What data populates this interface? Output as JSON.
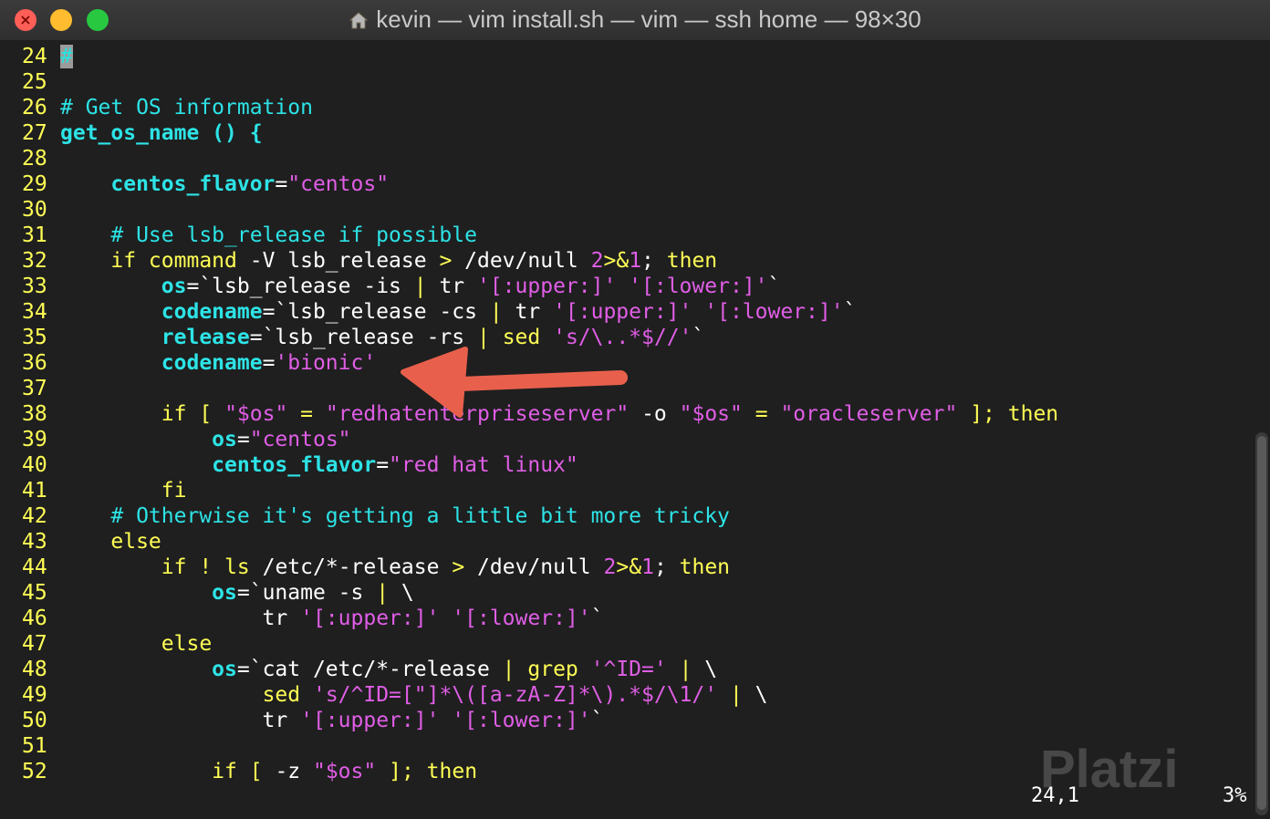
{
  "window": {
    "title": "kevin — vim install.sh — vim — ssh home — 98×30",
    "icon": "home-icon"
  },
  "editor": {
    "lines": [
      {
        "n": "24",
        "tokens": [
          {
            "t": "#",
            "c": "cur"
          }
        ]
      },
      {
        "n": "25",
        "tokens": []
      },
      {
        "n": "26",
        "tokens": [
          {
            "t": "# Get OS information",
            "c": "cmt"
          }
        ]
      },
      {
        "n": "27",
        "tokens": [
          {
            "t": "get_os_name () {",
            "c": "fn"
          }
        ]
      },
      {
        "n": "28",
        "tokens": []
      },
      {
        "n": "29",
        "tokens": [
          {
            "t": "    ",
            "c": "wh"
          },
          {
            "t": "centos_flavor",
            "c": "var"
          },
          {
            "t": "=",
            "c": "wh"
          },
          {
            "t": "\"centos\"",
            "c": "str"
          }
        ]
      },
      {
        "n": "30",
        "tokens": []
      },
      {
        "n": "31",
        "tokens": [
          {
            "t": "    ",
            "c": "wh"
          },
          {
            "t": "# Use lsb_release if possible",
            "c": "cmt"
          }
        ]
      },
      {
        "n": "32",
        "tokens": [
          {
            "t": "    ",
            "c": "wh"
          },
          {
            "t": "if command",
            "c": "kw"
          },
          {
            "t": " -V lsb_release ",
            "c": "wh"
          },
          {
            "t": ">",
            "c": "kw"
          },
          {
            "t": " /dev/null ",
            "c": "wh"
          },
          {
            "t": "2",
            "c": "str"
          },
          {
            "t": ">&",
            "c": "kw"
          },
          {
            "t": "1",
            "c": "str"
          },
          {
            "t": "; ",
            "c": "wh"
          },
          {
            "t": "then",
            "c": "kw"
          }
        ]
      },
      {
        "n": "33",
        "tokens": [
          {
            "t": "        ",
            "c": "wh"
          },
          {
            "t": "os",
            "c": "var"
          },
          {
            "t": "=`lsb_release -is ",
            "c": "wh"
          },
          {
            "t": "|",
            "c": "kw"
          },
          {
            "t": " tr ",
            "c": "wh"
          },
          {
            "t": "'[:upper:]'",
            "c": "str"
          },
          {
            "t": " ",
            "c": "wh"
          },
          {
            "t": "'[:lower:]'",
            "c": "str"
          },
          {
            "t": "`",
            "c": "wh"
          }
        ]
      },
      {
        "n": "34",
        "tokens": [
          {
            "t": "        ",
            "c": "wh"
          },
          {
            "t": "codename",
            "c": "var"
          },
          {
            "t": "=`lsb_release -cs ",
            "c": "wh"
          },
          {
            "t": "|",
            "c": "kw"
          },
          {
            "t": " tr ",
            "c": "wh"
          },
          {
            "t": "'[:upper:]'",
            "c": "str"
          },
          {
            "t": " ",
            "c": "wh"
          },
          {
            "t": "'[:lower:]'",
            "c": "str"
          },
          {
            "t": "`",
            "c": "wh"
          }
        ]
      },
      {
        "n": "35",
        "tokens": [
          {
            "t": "        ",
            "c": "wh"
          },
          {
            "t": "release",
            "c": "var"
          },
          {
            "t": "=`lsb_release -rs ",
            "c": "wh"
          },
          {
            "t": "|",
            "c": "kw"
          },
          {
            "t": " ",
            "c": "wh"
          },
          {
            "t": "sed",
            "c": "kw"
          },
          {
            "t": " ",
            "c": "wh"
          },
          {
            "t": "'s/\\..*$//'",
            "c": "str"
          },
          {
            "t": "`",
            "c": "wh"
          }
        ]
      },
      {
        "n": "36",
        "tokens": [
          {
            "t": "        ",
            "c": "wh"
          },
          {
            "t": "codename",
            "c": "var"
          },
          {
            "t": "=",
            "c": "wh"
          },
          {
            "t": "'bionic'",
            "c": "str"
          }
        ]
      },
      {
        "n": "37",
        "tokens": []
      },
      {
        "n": "38",
        "tokens": [
          {
            "t": "        ",
            "c": "wh"
          },
          {
            "t": "if",
            "c": "kw"
          },
          {
            "t": " ",
            "c": "wh"
          },
          {
            "t": "[",
            "c": "kw"
          },
          {
            "t": " ",
            "c": "wh"
          },
          {
            "t": "\"$os\"",
            "c": "str"
          },
          {
            "t": " ",
            "c": "wh"
          },
          {
            "t": "=",
            "c": "kw"
          },
          {
            "t": " ",
            "c": "wh"
          },
          {
            "t": "\"redhatenterpriseserver\"",
            "c": "str"
          },
          {
            "t": " -o ",
            "c": "wh"
          },
          {
            "t": "\"$os\"",
            "c": "str"
          },
          {
            "t": " ",
            "c": "wh"
          },
          {
            "t": "=",
            "c": "kw"
          },
          {
            "t": " ",
            "c": "wh"
          },
          {
            "t": "\"oracleserver\"",
            "c": "str"
          },
          {
            "t": " ",
            "c": "wh"
          },
          {
            "t": "];",
            "c": "kw"
          },
          {
            "t": " ",
            "c": "wh"
          },
          {
            "t": "then",
            "c": "kw"
          }
        ]
      },
      {
        "n": "39",
        "tokens": [
          {
            "t": "            ",
            "c": "wh"
          },
          {
            "t": "os",
            "c": "var"
          },
          {
            "t": "=",
            "c": "wh"
          },
          {
            "t": "\"centos\"",
            "c": "str"
          }
        ]
      },
      {
        "n": "40",
        "tokens": [
          {
            "t": "            ",
            "c": "wh"
          },
          {
            "t": "centos_flavor",
            "c": "var"
          },
          {
            "t": "=",
            "c": "wh"
          },
          {
            "t": "\"red hat linux\"",
            "c": "str"
          }
        ]
      },
      {
        "n": "41",
        "tokens": [
          {
            "t": "        ",
            "c": "wh"
          },
          {
            "t": "fi",
            "c": "kw"
          }
        ]
      },
      {
        "n": "42",
        "tokens": [
          {
            "t": "    ",
            "c": "wh"
          },
          {
            "t": "# Otherwise it's getting a little bit more tricky",
            "c": "cmt"
          }
        ]
      },
      {
        "n": "43",
        "tokens": [
          {
            "t": "    ",
            "c": "wh"
          },
          {
            "t": "else",
            "c": "kw"
          }
        ]
      },
      {
        "n": "44",
        "tokens": [
          {
            "t": "        ",
            "c": "wh"
          },
          {
            "t": "if",
            "c": "kw"
          },
          {
            "t": " ",
            "c": "wh"
          },
          {
            "t": "!",
            "c": "kw"
          },
          {
            "t": " ",
            "c": "wh"
          },
          {
            "t": "ls",
            "c": "kw"
          },
          {
            "t": " /etc/*-release ",
            "c": "wh"
          },
          {
            "t": ">",
            "c": "kw"
          },
          {
            "t": " /dev/null ",
            "c": "wh"
          },
          {
            "t": "2",
            "c": "str"
          },
          {
            "t": ">&",
            "c": "kw"
          },
          {
            "t": "1",
            "c": "str"
          },
          {
            "t": "; ",
            "c": "wh"
          },
          {
            "t": "then",
            "c": "kw"
          }
        ]
      },
      {
        "n": "45",
        "tokens": [
          {
            "t": "            ",
            "c": "wh"
          },
          {
            "t": "os",
            "c": "var"
          },
          {
            "t": "=`uname -s ",
            "c": "wh"
          },
          {
            "t": "|",
            "c": "kw"
          },
          {
            "t": " \\",
            "c": "wh"
          }
        ]
      },
      {
        "n": "46",
        "tokens": [
          {
            "t": "                tr ",
            "c": "wh"
          },
          {
            "t": "'[:upper:]'",
            "c": "str"
          },
          {
            "t": " ",
            "c": "wh"
          },
          {
            "t": "'[:lower:]'",
            "c": "str"
          },
          {
            "t": "`",
            "c": "wh"
          }
        ]
      },
      {
        "n": "47",
        "tokens": [
          {
            "t": "        ",
            "c": "wh"
          },
          {
            "t": "else",
            "c": "kw"
          }
        ]
      },
      {
        "n": "48",
        "tokens": [
          {
            "t": "            ",
            "c": "wh"
          },
          {
            "t": "os",
            "c": "var"
          },
          {
            "t": "=`cat /etc/*-release ",
            "c": "wh"
          },
          {
            "t": "|",
            "c": "kw"
          },
          {
            "t": " ",
            "c": "wh"
          },
          {
            "t": "grep",
            "c": "kw"
          },
          {
            "t": " ",
            "c": "wh"
          },
          {
            "t": "'^ID='",
            "c": "str"
          },
          {
            "t": " ",
            "c": "wh"
          },
          {
            "t": "|",
            "c": "kw"
          },
          {
            "t": " \\",
            "c": "wh"
          }
        ]
      },
      {
        "n": "49",
        "tokens": [
          {
            "t": "                ",
            "c": "wh"
          },
          {
            "t": "sed",
            "c": "kw"
          },
          {
            "t": " ",
            "c": "wh"
          },
          {
            "t": "'s/^ID=[\"]*\\([a-zA-Z]*\\).*$/\\1/'",
            "c": "str"
          },
          {
            "t": " ",
            "c": "wh"
          },
          {
            "t": "|",
            "c": "kw"
          },
          {
            "t": " \\",
            "c": "wh"
          }
        ]
      },
      {
        "n": "50",
        "tokens": [
          {
            "t": "                tr ",
            "c": "wh"
          },
          {
            "t": "'[:upper:]'",
            "c": "str"
          },
          {
            "t": " ",
            "c": "wh"
          },
          {
            "t": "'[:lower:]'",
            "c": "str"
          },
          {
            "t": "`",
            "c": "wh"
          }
        ]
      },
      {
        "n": "51",
        "tokens": []
      },
      {
        "n": "52",
        "tokens": [
          {
            "t": "            ",
            "c": "wh"
          },
          {
            "t": "if",
            "c": "kw"
          },
          {
            "t": " ",
            "c": "wh"
          },
          {
            "t": "[",
            "c": "kw"
          },
          {
            "t": " -z ",
            "c": "wh"
          },
          {
            "t": "\"$os\"",
            "c": "str"
          },
          {
            "t": " ",
            "c": "wh"
          },
          {
            "t": "];",
            "c": "kw"
          },
          {
            "t": " ",
            "c": "wh"
          },
          {
            "t": "then",
            "c": "kw"
          }
        ]
      }
    ]
  },
  "status": {
    "position": "24,1",
    "percent": "3%"
  },
  "watermark": "Platzi",
  "colors": {
    "background": "#1f1f1f",
    "line_number": "#fffe55",
    "comment": "#2de3e6",
    "string": "#e05ee6",
    "keyword": "#fffe55",
    "annotation_arrow": "#e8604c"
  }
}
